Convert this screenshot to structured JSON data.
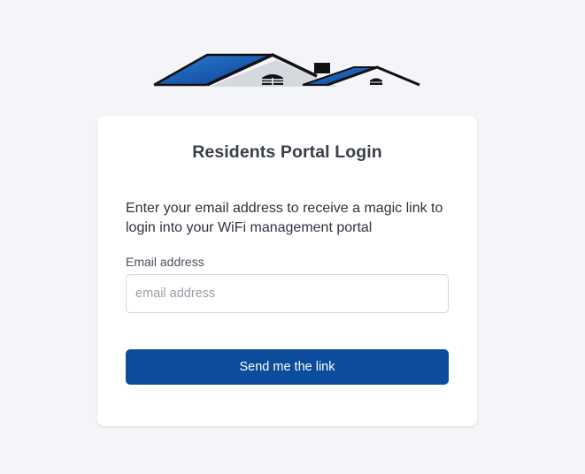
{
  "header": {
    "logo_icon": "houses-roof-logo",
    "brand_colors": {
      "roof_blue": "#1c5fb8",
      "roof_dark": "#0d2f6b",
      "outline": "#111111"
    }
  },
  "login": {
    "title": "Residents Portal Login",
    "description": "Enter your email address to receive a magic link to login into your WiFi management portal",
    "email_label": "Email address",
    "email_placeholder": "email address",
    "email_value": "",
    "submit_label": "Send me the link",
    "accent_color": "#0b4c9c"
  }
}
